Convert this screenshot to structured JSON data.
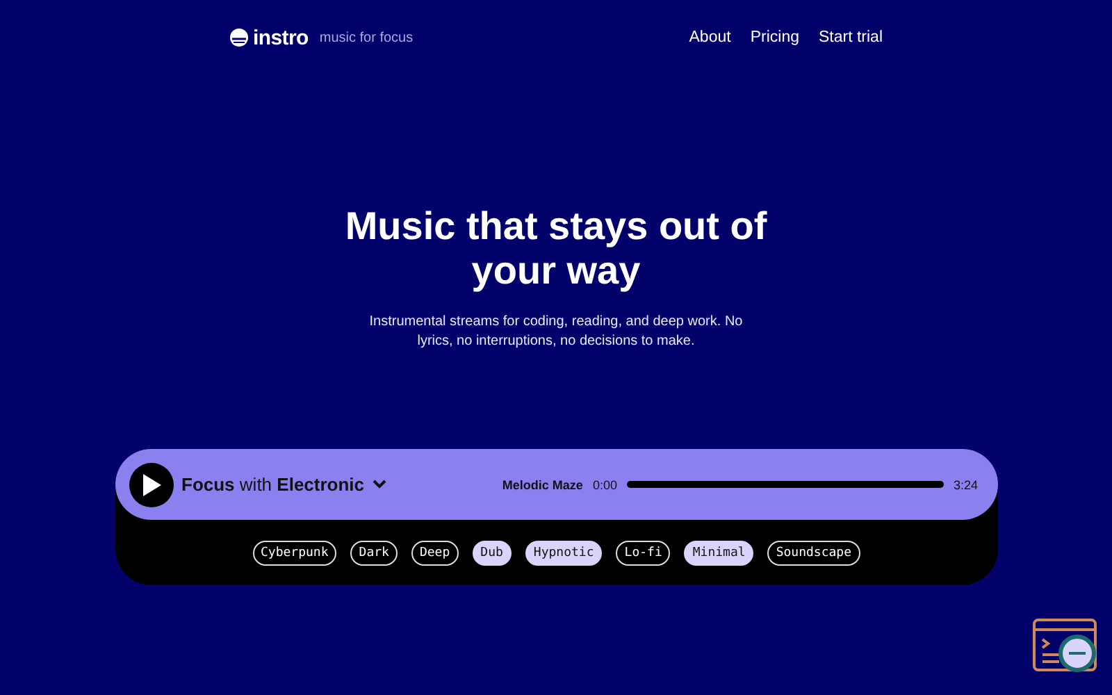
{
  "header": {
    "logo": "instro",
    "tagline": "music for focus",
    "nav": [
      "About",
      "Pricing",
      "Start trial"
    ]
  },
  "hero": {
    "title": "Music that stays out of your way",
    "subtitle": "Instrumental streams for coding, reading, and deep work. No lyrics, no interruptions, no decisions to make."
  },
  "player": {
    "mode": "Focus",
    "joiner": "with",
    "genre": "Electronic",
    "track": "Melodic Maze",
    "elapsed": "0:00",
    "duration": "3:24"
  },
  "tags": [
    {
      "label": "Cyberpunk",
      "selected": false
    },
    {
      "label": "Dark",
      "selected": false
    },
    {
      "label": "Deep",
      "selected": false
    },
    {
      "label": "Dub",
      "selected": true
    },
    {
      "label": "Hypnotic",
      "selected": true
    },
    {
      "label": "Lo-fi",
      "selected": false
    },
    {
      "label": "Minimal",
      "selected": true
    },
    {
      "label": "Soundscape",
      "selected": false
    }
  ]
}
